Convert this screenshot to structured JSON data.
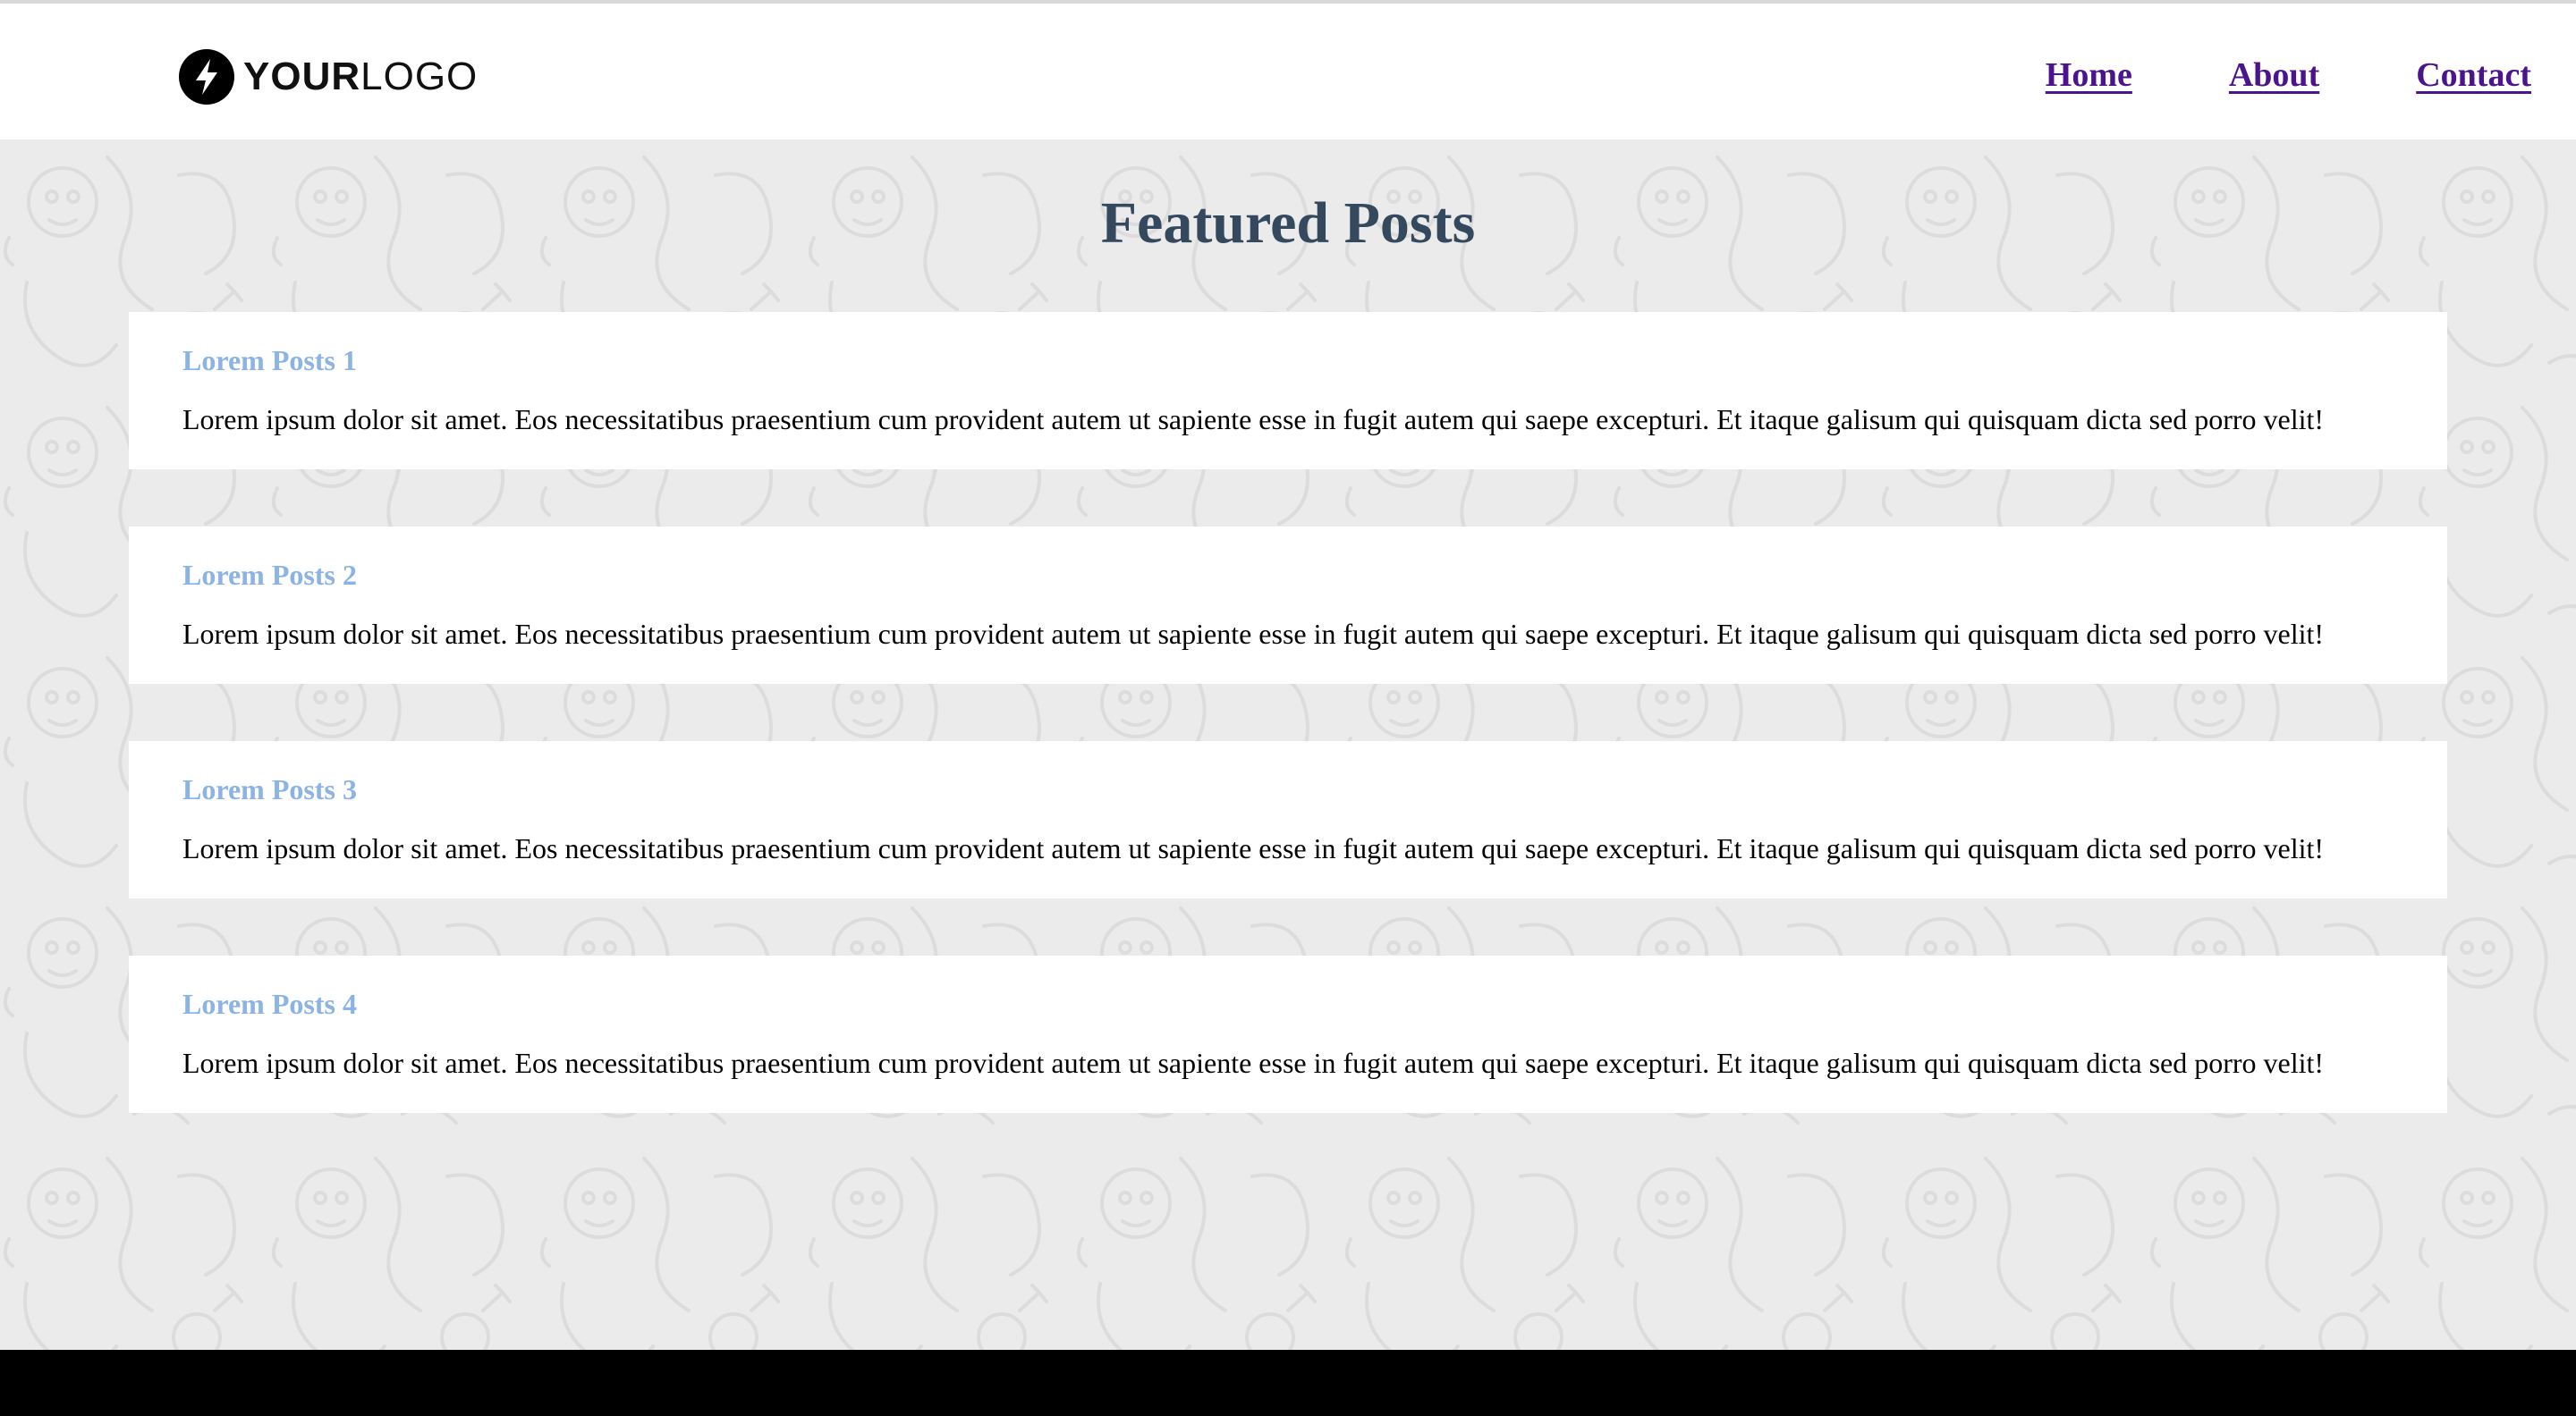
{
  "header": {
    "logo": {
      "bold": "YOUR",
      "light": "LOGO",
      "icon": "lightning-bolt-icon"
    },
    "nav": [
      {
        "label": "Home"
      },
      {
        "label": "About"
      },
      {
        "label": "Contact"
      }
    ]
  },
  "main": {
    "title": "Featured Posts",
    "posts": [
      {
        "title": "Lorem Posts 1",
        "body": "Lorem ipsum dolor sit amet. Eos necessitatibus praesentium cum provident autem ut sapiente esse in fugit autem qui saepe excepturi. Et itaque galisum qui quisquam dicta sed porro velit!"
      },
      {
        "title": "Lorem Posts 2",
        "body": "Lorem ipsum dolor sit amet. Eos necessitatibus praesentium cum provident autem ut sapiente esse in fugit autem qui saepe excepturi. Et itaque galisum qui quisquam dicta sed porro velit!"
      },
      {
        "title": "Lorem Posts 3",
        "body": "Lorem ipsum dolor sit amet. Eos necessitatibus praesentium cum provident autem ut sapiente esse in fugit autem qui saepe excepturi. Et itaque galisum qui quisquam dicta sed porro velit!"
      },
      {
        "title": "Lorem Posts 4",
        "body": "Lorem ipsum dolor sit amet. Eos necessitatibus praesentium cum provident autem ut sapiente esse in fugit autem qui saepe excepturi. Et itaque galisum qui quisquam dicta sed porro velit!"
      }
    ]
  },
  "colors": {
    "nav_link": "#4a148c",
    "page_title": "#34495e",
    "post_title": "#8bb3e3",
    "background": "#ebebeb",
    "footer": "#000000"
  }
}
